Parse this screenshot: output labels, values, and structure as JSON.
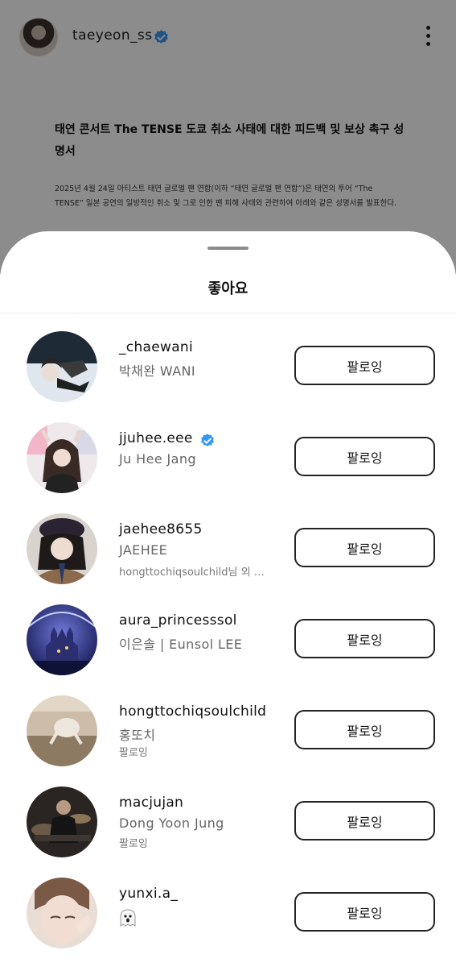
{
  "post": {
    "username": "taeyeon_ss",
    "headline": "태연 콘서트 The TENSE 도쿄 취소 사태에 대한 피드백 및 보상 촉구 성명서",
    "body": "2025년 4월 24일 아티스트 태연 글로벌 팬 연합(이하 “태연 글로벌 팬 연합”)은 태연의 투어 “The TENSE” 일본 공연의 일방적인 취소 및 그로 인한 팬 피해 사태와 관련하여 아래와 같은 성명서를 발표한다."
  },
  "sheet": {
    "title": "좋아요"
  },
  "users": [
    {
      "username": "_chaewani",
      "display_name": "박채완 WANI",
      "subtext": "",
      "verified": false,
      "button": "팔로잉"
    },
    {
      "username": "jjuhee.eee",
      "display_name": "Ju Hee  Jang",
      "subtext": "",
      "verified": true,
      "button": "팔로잉"
    },
    {
      "username": "jaehee8655",
      "display_name": "JAEHEE",
      "subtext": "hongttochiqsoulchild님 외 …",
      "verified": false,
      "button": "팔로잉"
    },
    {
      "username": "aura_princesssol",
      "display_name": "이은솔 | Eunsol LEE",
      "subtext": "",
      "verified": false,
      "button": "팔로잉"
    },
    {
      "username": "hongttochiqsoulchild",
      "display_name": "홍또치",
      "subtext": "팔로잉",
      "verified": false,
      "button": "팔로잉"
    },
    {
      "username": "macjujan",
      "display_name": "Dong Yoon Jung",
      "subtext": "팔로잉",
      "verified": false,
      "button": "팔로잉"
    },
    {
      "username": "yunxi.a_",
      "display_name": "",
      "subtext": "",
      "verified": false,
      "button": "팔로잉"
    }
  ],
  "colors": {
    "verified_badge": "#3897f0",
    "dim_overlay": "rgba(0,0,0,0.45)"
  },
  "icons": {
    "verified": "verified-badge-icon",
    "more": "more-vertical-icon",
    "ghost": "ghost-emoji-icon"
  }
}
